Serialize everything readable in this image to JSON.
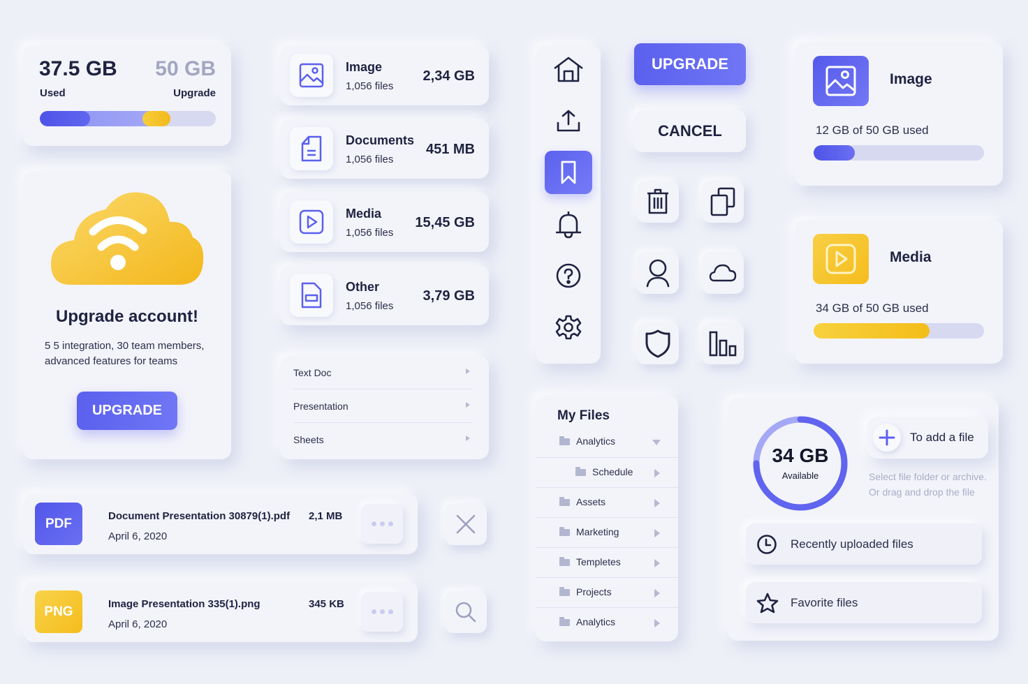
{
  "storage": {
    "used_value": "37.5 GB",
    "total_value": "50 GB",
    "used_label": "Used",
    "upgrade_label": "Upgrade",
    "used_fraction": 0.75,
    "colors": {
      "primary": "#5b60ee",
      "secondary": "#8f94f4",
      "accent": "#f6c52a",
      "track": "#d6d9ef"
    }
  },
  "upgrade_card": {
    "title": "Upgrade account!",
    "description": "5 5 integration, 30 team members, advanced features for teams",
    "button_label": "UPGRADE",
    "icon": "cloud-wifi-icon"
  },
  "categories": [
    {
      "name": "Image",
      "count": "1,056 files",
      "size": "2,34 GB",
      "icon": "image-icon"
    },
    {
      "name": "Documents",
      "count": "1,056 files",
      "size": "451 MB",
      "icon": "document-icon"
    },
    {
      "name": "Media",
      "count": "1,056 files",
      "size": "15,45 GB",
      "icon": "play-icon"
    },
    {
      "name": "Other",
      "count": "1,056 files",
      "size": "3,79 GB",
      "icon": "file-icon"
    }
  ],
  "submenu": [
    {
      "label": "Text Doc"
    },
    {
      "label": "Presentation"
    },
    {
      "label": "Sheets"
    }
  ],
  "sidebar": {
    "items": [
      {
        "icon": "home-icon",
        "active": false
      },
      {
        "icon": "upload-icon",
        "active": false
      },
      {
        "icon": "bookmark-icon",
        "active": true
      },
      {
        "icon": "bell-icon",
        "active": false
      },
      {
        "icon": "help-icon",
        "active": false
      },
      {
        "icon": "gear-icon",
        "active": false
      }
    ]
  },
  "buttons": {
    "upgrade_label": "UPGRADE",
    "cancel_label": "CANCEL"
  },
  "icon_buttons": [
    "trash-icon",
    "copy-icon",
    "user-icon",
    "cloud-icon",
    "shield-icon",
    "chart-icon"
  ],
  "usage_cards": [
    {
      "title": "Image",
      "text": "12 GB of 50 GB used",
      "fraction": 0.24,
      "color": "#5b60ee",
      "icon": "image-icon"
    },
    {
      "title": "Media",
      "text": "34 GB of 50 GB used",
      "fraction": 0.68,
      "color": "#f6c52a",
      "icon": "play-icon"
    }
  ],
  "my_files": {
    "title": "My Files",
    "items": [
      {
        "label": "Analytics",
        "expanded": true,
        "indent": 0
      },
      {
        "label": "Schedule",
        "expanded": false,
        "indent": 1
      },
      {
        "label": "Assets",
        "expanded": false,
        "indent": 0
      },
      {
        "label": "Marketing",
        "expanded": false,
        "indent": 0
      },
      {
        "label": "Templetes",
        "expanded": false,
        "indent": 0
      },
      {
        "label": "Projects",
        "expanded": false,
        "indent": 0
      },
      {
        "label": "Analytics",
        "expanded": false,
        "indent": 0
      }
    ]
  },
  "upload": {
    "available_value": "34 GB",
    "available_label": "Available",
    "ring_fraction": 0.75,
    "add_label": "To add a file",
    "hint": "Select file folder or archive. Or drag and drop the file",
    "recent_label": "Recently uploaded files",
    "favorite_label": "Favorite files"
  },
  "files": [
    {
      "type": "PDF",
      "name": "Document Presentation 30879(1).pdf",
      "date": "April 6, 2020",
      "size": "2,1 MB",
      "color": "#5b60ee"
    },
    {
      "type": "PNG",
      "name": "Image Presentation 335(1).png",
      "date": "April 6, 2020",
      "size": "345 KB",
      "color": "#f6c52a"
    }
  ],
  "side_actions": [
    "close-icon",
    "search-icon"
  ]
}
